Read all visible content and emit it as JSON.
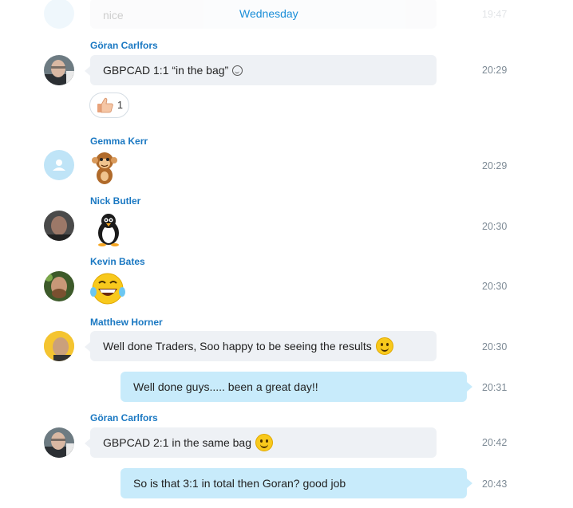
{
  "top": {
    "faded_text": "nice",
    "day_label": "Wednesday",
    "faded_time": "19:47"
  },
  "messages": [
    {
      "sender": "Göran Carlfors",
      "text": "GBPCAD 1:1 “in the bag”",
      "time": "20:29",
      "reaction_count": "1"
    },
    {
      "sender": "Gemma Kerr",
      "sticker": "monkey-sticker",
      "time": "20:29"
    },
    {
      "sender": "Nick Butler",
      "sticker": "penguin-sticker",
      "time": "20:30"
    },
    {
      "sender": "Kevin Bates",
      "sticker": "laughing-emoji",
      "time": "20:30"
    },
    {
      "sender": "Matthew Horner",
      "text": "Well done Traders, Soo happy to be seeing the results",
      "time": "20:30"
    },
    {
      "outgoing": true,
      "text": "Well done guys..... been a great day!!",
      "time": "20:31"
    },
    {
      "sender": "Göran Carlfors",
      "text": "GBPCAD 2:1 in the same bag",
      "time": "20:42"
    },
    {
      "outgoing": true,
      "text": "So is that 3:1 in total then Goran?  good job",
      "time": "20:43"
    }
  ],
  "colors": {
    "incoming_bubble": "#eef1f5",
    "outgoing_bubble": "#c8ebfb",
    "sender_name": "#1a78c2",
    "accent": "#1a8ed8"
  }
}
